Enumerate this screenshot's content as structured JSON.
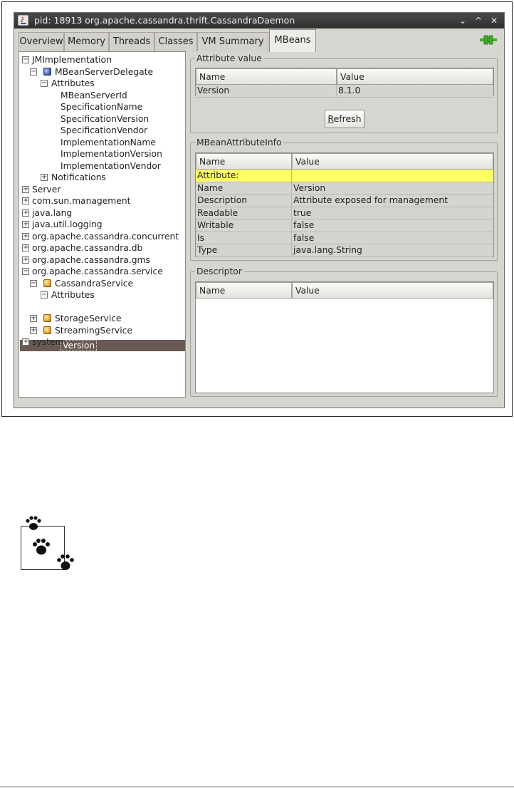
{
  "window": {
    "title": "pid: 18913 org.apache.cassandra.thrift.CassandraDaemon",
    "controls": {
      "minimize": "⌄",
      "maximize": "^",
      "close": "✕"
    }
  },
  "tabs": [
    {
      "label": "Overview",
      "active": false
    },
    {
      "label": "Memory",
      "active": false
    },
    {
      "label": "Threads",
      "active": false
    },
    {
      "label": "Classes",
      "active": false
    },
    {
      "label": "VM Summary",
      "active": false
    },
    {
      "label": "MBeans",
      "active": true
    }
  ],
  "connection_icon": "plug-connected-icon",
  "tree": [
    {
      "label": "JMImplementation",
      "expander": "−",
      "icon": null
    },
    {
      "label": "MBeanServerDelegate",
      "expander": "−",
      "icon": "bean-blue-icon"
    },
    {
      "label": "Attributes",
      "expander": "−",
      "icon": null
    },
    {
      "label": "MBeanServerId",
      "expander": null,
      "icon": null
    },
    {
      "label": "SpecificationName",
      "expander": null,
      "icon": null
    },
    {
      "label": "SpecificationVersion",
      "expander": null,
      "icon": null
    },
    {
      "label": "SpecificationVendor",
      "expander": null,
      "icon": null
    },
    {
      "label": "ImplementationName",
      "expander": null,
      "icon": null
    },
    {
      "label": "ImplementationVersion",
      "expander": null,
      "icon": null
    },
    {
      "label": "ImplementationVendor",
      "expander": null,
      "icon": null
    },
    {
      "label": "Notifications",
      "expander": "+",
      "icon": null
    },
    {
      "label": "Server",
      "expander": "+",
      "icon": null
    },
    {
      "label": "com.sun.management",
      "expander": "+",
      "icon": null
    },
    {
      "label": "java.lang",
      "expander": "+",
      "icon": null
    },
    {
      "label": "java.util.logging",
      "expander": "+",
      "icon": null
    },
    {
      "label": "org.apache.cassandra.concurrent",
      "expander": "+",
      "icon": null
    },
    {
      "label": "org.apache.cassandra.db",
      "expander": "+",
      "icon": null
    },
    {
      "label": "org.apache.cassandra.gms",
      "expander": "+",
      "icon": null
    },
    {
      "label": "org.apache.cassandra.service",
      "expander": "−",
      "icon": null
    },
    {
      "label": "CassandraService",
      "expander": "−",
      "icon": "bean-gold-icon"
    },
    {
      "label": "Attributes",
      "expander": "−",
      "icon": null
    },
    {
      "label": "Version",
      "expander": null,
      "icon": null,
      "selected": true
    },
    {
      "label": "StorageService",
      "expander": "+",
      "icon": "bean-gold-icon"
    },
    {
      "label": "StreamingService",
      "expander": "+",
      "icon": "bean-gold-icon"
    },
    {
      "label": "system",
      "expander": "+",
      "icon": null
    }
  ],
  "attribute_value": {
    "title": "Attribute value",
    "columns": [
      "Name",
      "Value"
    ],
    "rows": [
      {
        "name": "Version",
        "value": "8.1.0"
      }
    ],
    "refresh_label": "Refresh"
  },
  "attribute_info": {
    "title": "MBeanAttributeInfo",
    "columns": [
      "Name",
      "Value"
    ],
    "rows": [
      {
        "name": "Attribute:",
        "value": "",
        "highlight": true
      },
      {
        "name": "Name",
        "value": "Version"
      },
      {
        "name": "Description",
        "value": "Attribute exposed for management"
      },
      {
        "name": "Readable",
        "value": "true"
      },
      {
        "name": "Writable",
        "value": "false"
      },
      {
        "name": "Is",
        "value": "false"
      },
      {
        "name": "Type",
        "value": "java.lang.String"
      }
    ]
  },
  "descriptor": {
    "title": "Descriptor",
    "columns": [
      "Name",
      "Value"
    ]
  },
  "note_icon": "paw-prints-icon",
  "colors": {
    "titlebar": "#3a3a3a",
    "window_bg": "#d7d5d0",
    "selection": "#6b5a53",
    "highlight_row": "#ffff66",
    "connected_plug": "#3fae2a"
  }
}
